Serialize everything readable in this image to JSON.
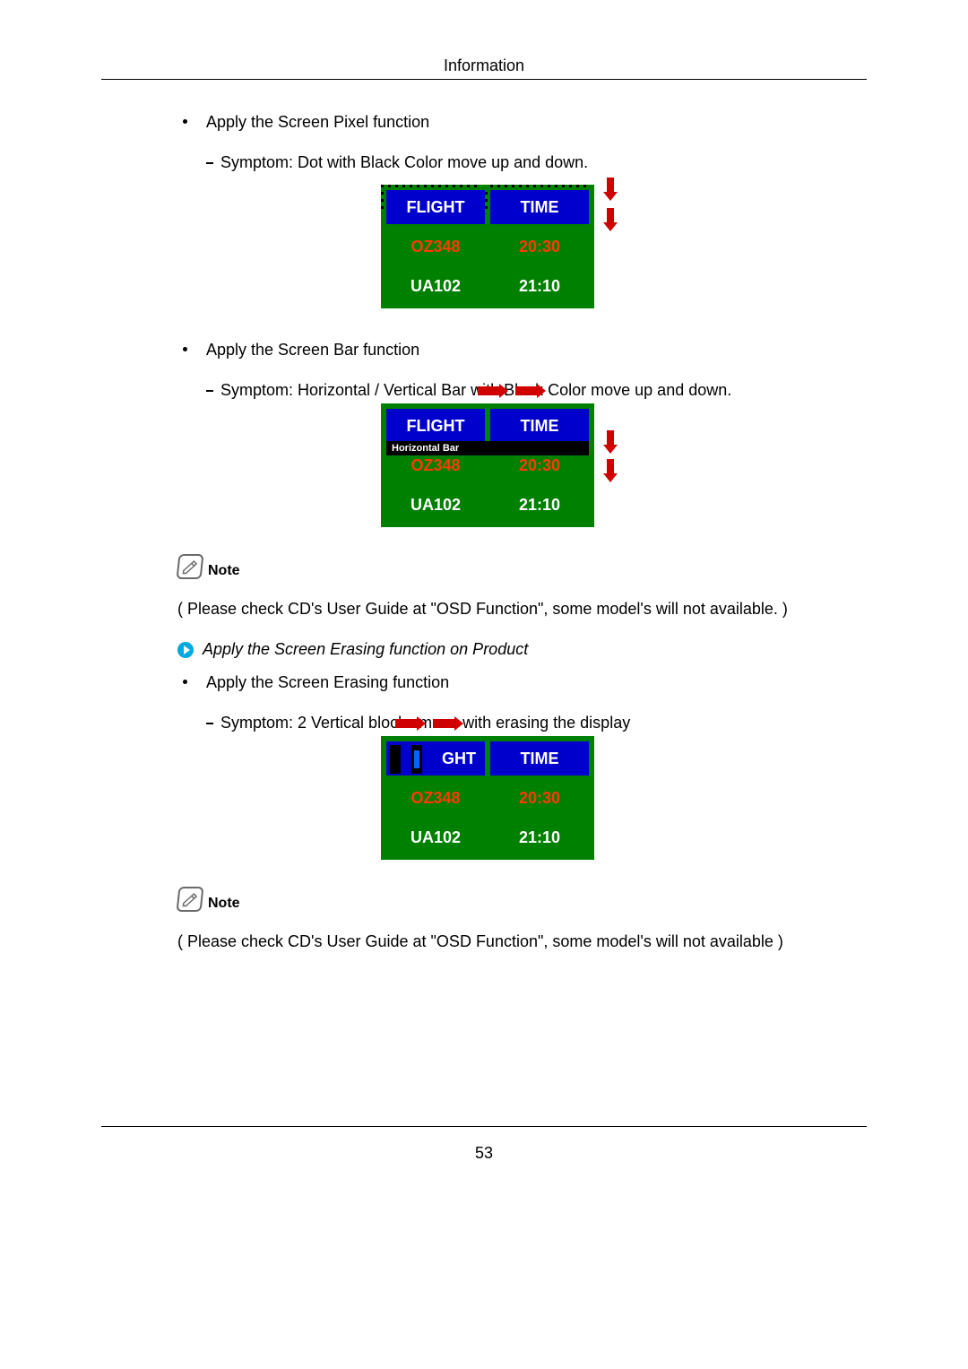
{
  "header": {
    "title": "Information"
  },
  "footer": {
    "page_number": "53"
  },
  "section1": {
    "heading": "Apply the Screen Pixel function",
    "symptom": "Symptom: Dot with Black Color move up and down."
  },
  "section2": {
    "heading": "Apply the Screen Bar function",
    "symptom": "Symptom: Horizontal / Vertical Bar with Black Color move up and down.",
    "bar_label": "Horizontal Bar"
  },
  "note1": {
    "label": "Note",
    "text": "( Please check CD's User Guide at \"OSD Function\", some model's will not available. )"
  },
  "blue_line": "Apply the Screen Erasing function on Product",
  "section3": {
    "heading": "Apply the Screen Erasing function",
    "symptom": "Symptom: 2 Vertical blocks move with erasing the display"
  },
  "note2": {
    "label": "Note",
    "text": "( Please check CD's User Guide at \"OSD Function\", some model's will not available )"
  },
  "table": {
    "h1": "FLIGHT",
    "h2": "TIME",
    "r1c1": "OZ348",
    "r1c2": "20:30",
    "r2c1": "UA102",
    "r2c2": "21:10"
  },
  "fig3": {
    "ght": "GHT"
  }
}
